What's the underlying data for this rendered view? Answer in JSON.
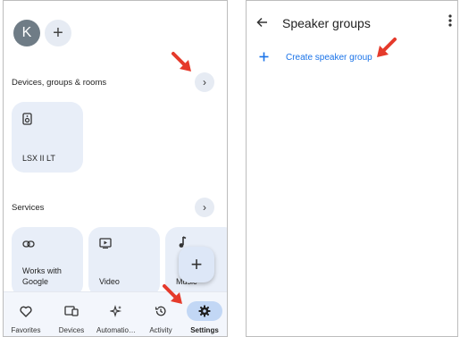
{
  "left": {
    "avatar_letter": "K",
    "add_home": "+",
    "section_devices": "Devices, groups & rooms",
    "section_services": "Services",
    "chevron": "›",
    "device_card": {
      "label": "LSX II LT",
      "icon": "speaker-icon"
    },
    "service_cards": [
      {
        "label_line1": "Works with",
        "label_line2": "Google",
        "icon": "link-icon"
      },
      {
        "label_line1": "",
        "label_line2": "Video",
        "icon": "video-icon"
      },
      {
        "label_line1": "",
        "label_line2": "Music",
        "icon": "music-note-icon"
      }
    ],
    "fab": "+",
    "nav": [
      {
        "label": "Favorites",
        "icon": "heart-icon"
      },
      {
        "label": "Devices",
        "icon": "devices-icon"
      },
      {
        "label": "Automatio…",
        "icon": "sparkle-icon"
      },
      {
        "label": "Activity",
        "icon": "history-icon"
      },
      {
        "label": "Settings",
        "icon": "gear-icon",
        "active": true
      }
    ]
  },
  "right": {
    "title": "Speaker groups",
    "create_label": "Create speaker group"
  },
  "colors": {
    "accent_blue": "#1a73e8",
    "card_bg": "#e8eef8",
    "annotation_arrow": "#e53a2b"
  }
}
